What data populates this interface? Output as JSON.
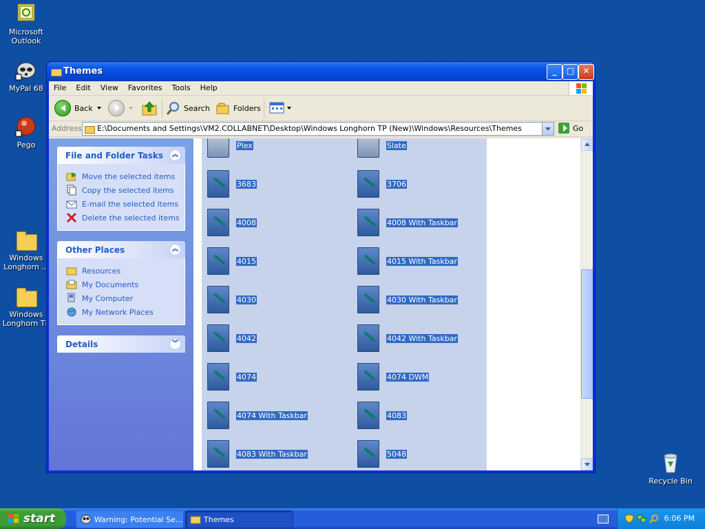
{
  "desktop": {
    "icons": [
      {
        "name": "outlook",
        "label": "Microsoft Outlook"
      },
      {
        "name": "mypal",
        "label": "MyPal 68"
      },
      {
        "name": "pego",
        "label": "Pego"
      },
      {
        "name": "longhorn1",
        "label": "Windows Longhorn ..."
      },
      {
        "name": "longhorn2",
        "label": "Windows Longhorn TP"
      },
      {
        "name": "recycle",
        "label": "Recycle Bin"
      }
    ]
  },
  "window": {
    "title": "Themes",
    "menu": [
      "File",
      "Edit",
      "View",
      "Favorites",
      "Tools",
      "Help"
    ],
    "toolbar": {
      "back": "Back",
      "search": "Search",
      "folders": "Folders"
    },
    "address": {
      "label": "Address",
      "value": "E:\\Documents and Settings\\VM2.COLLABNET\\Desktop\\Windows Longhorn TP (New)\\Windows\\Resources\\Themes",
      "go": "Go"
    }
  },
  "tasks": {
    "file_folder": {
      "title": "File and Folder Tasks",
      "items": [
        "Move the selected items",
        "Copy the selected items",
        "E-mail the selected items",
        "Delete the selected items"
      ]
    },
    "other_places": {
      "title": "Other Places",
      "items": [
        "Resources",
        "My Documents",
        "My Computer",
        "My Network Places"
      ]
    },
    "details": {
      "title": "Details"
    }
  },
  "files": {
    "left": [
      "Plex",
      "3683",
      "4008",
      "4015",
      "4030",
      "4042",
      "4074",
      "4074 With Taskbar",
      "4083 With Taskbar"
    ],
    "right": [
      "Slate",
      "3706",
      "4008 With Taskbar",
      "4015 With Taskbar",
      "4030 With Taskbar",
      "4042 With Taskbar",
      "4074 DWM",
      "4083",
      "5048"
    ]
  },
  "taskbar": {
    "start": "start",
    "tasks": [
      "Warning: Potential Se...",
      "Themes"
    ],
    "clock": "6:06 PM"
  }
}
